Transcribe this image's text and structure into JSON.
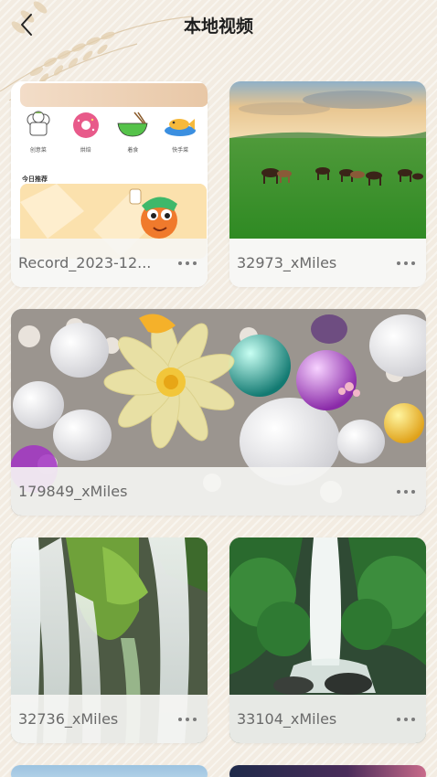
{
  "header": {
    "title": "本地视频"
  },
  "videos": [
    {
      "name": "Record_2023-12..."
    },
    {
      "name": "32973_xMiles"
    },
    {
      "name": "179849_xMiles"
    },
    {
      "name": "32736_xMiles"
    },
    {
      "name": "33104_xMiles"
    }
  ],
  "recipe_preview": {
    "categories": [
      "创意菜",
      "烘焙",
      "着食",
      "快手菜"
    ],
    "section_label": "今日推荐"
  },
  "colors": {
    "background": "#f3ece2",
    "card": "#ffffff",
    "caption_text": "#6a6a6a",
    "title_text": "#1e1e1e"
  },
  "icons": [
    "back-arrow-icon",
    "more-dots-icon"
  ]
}
